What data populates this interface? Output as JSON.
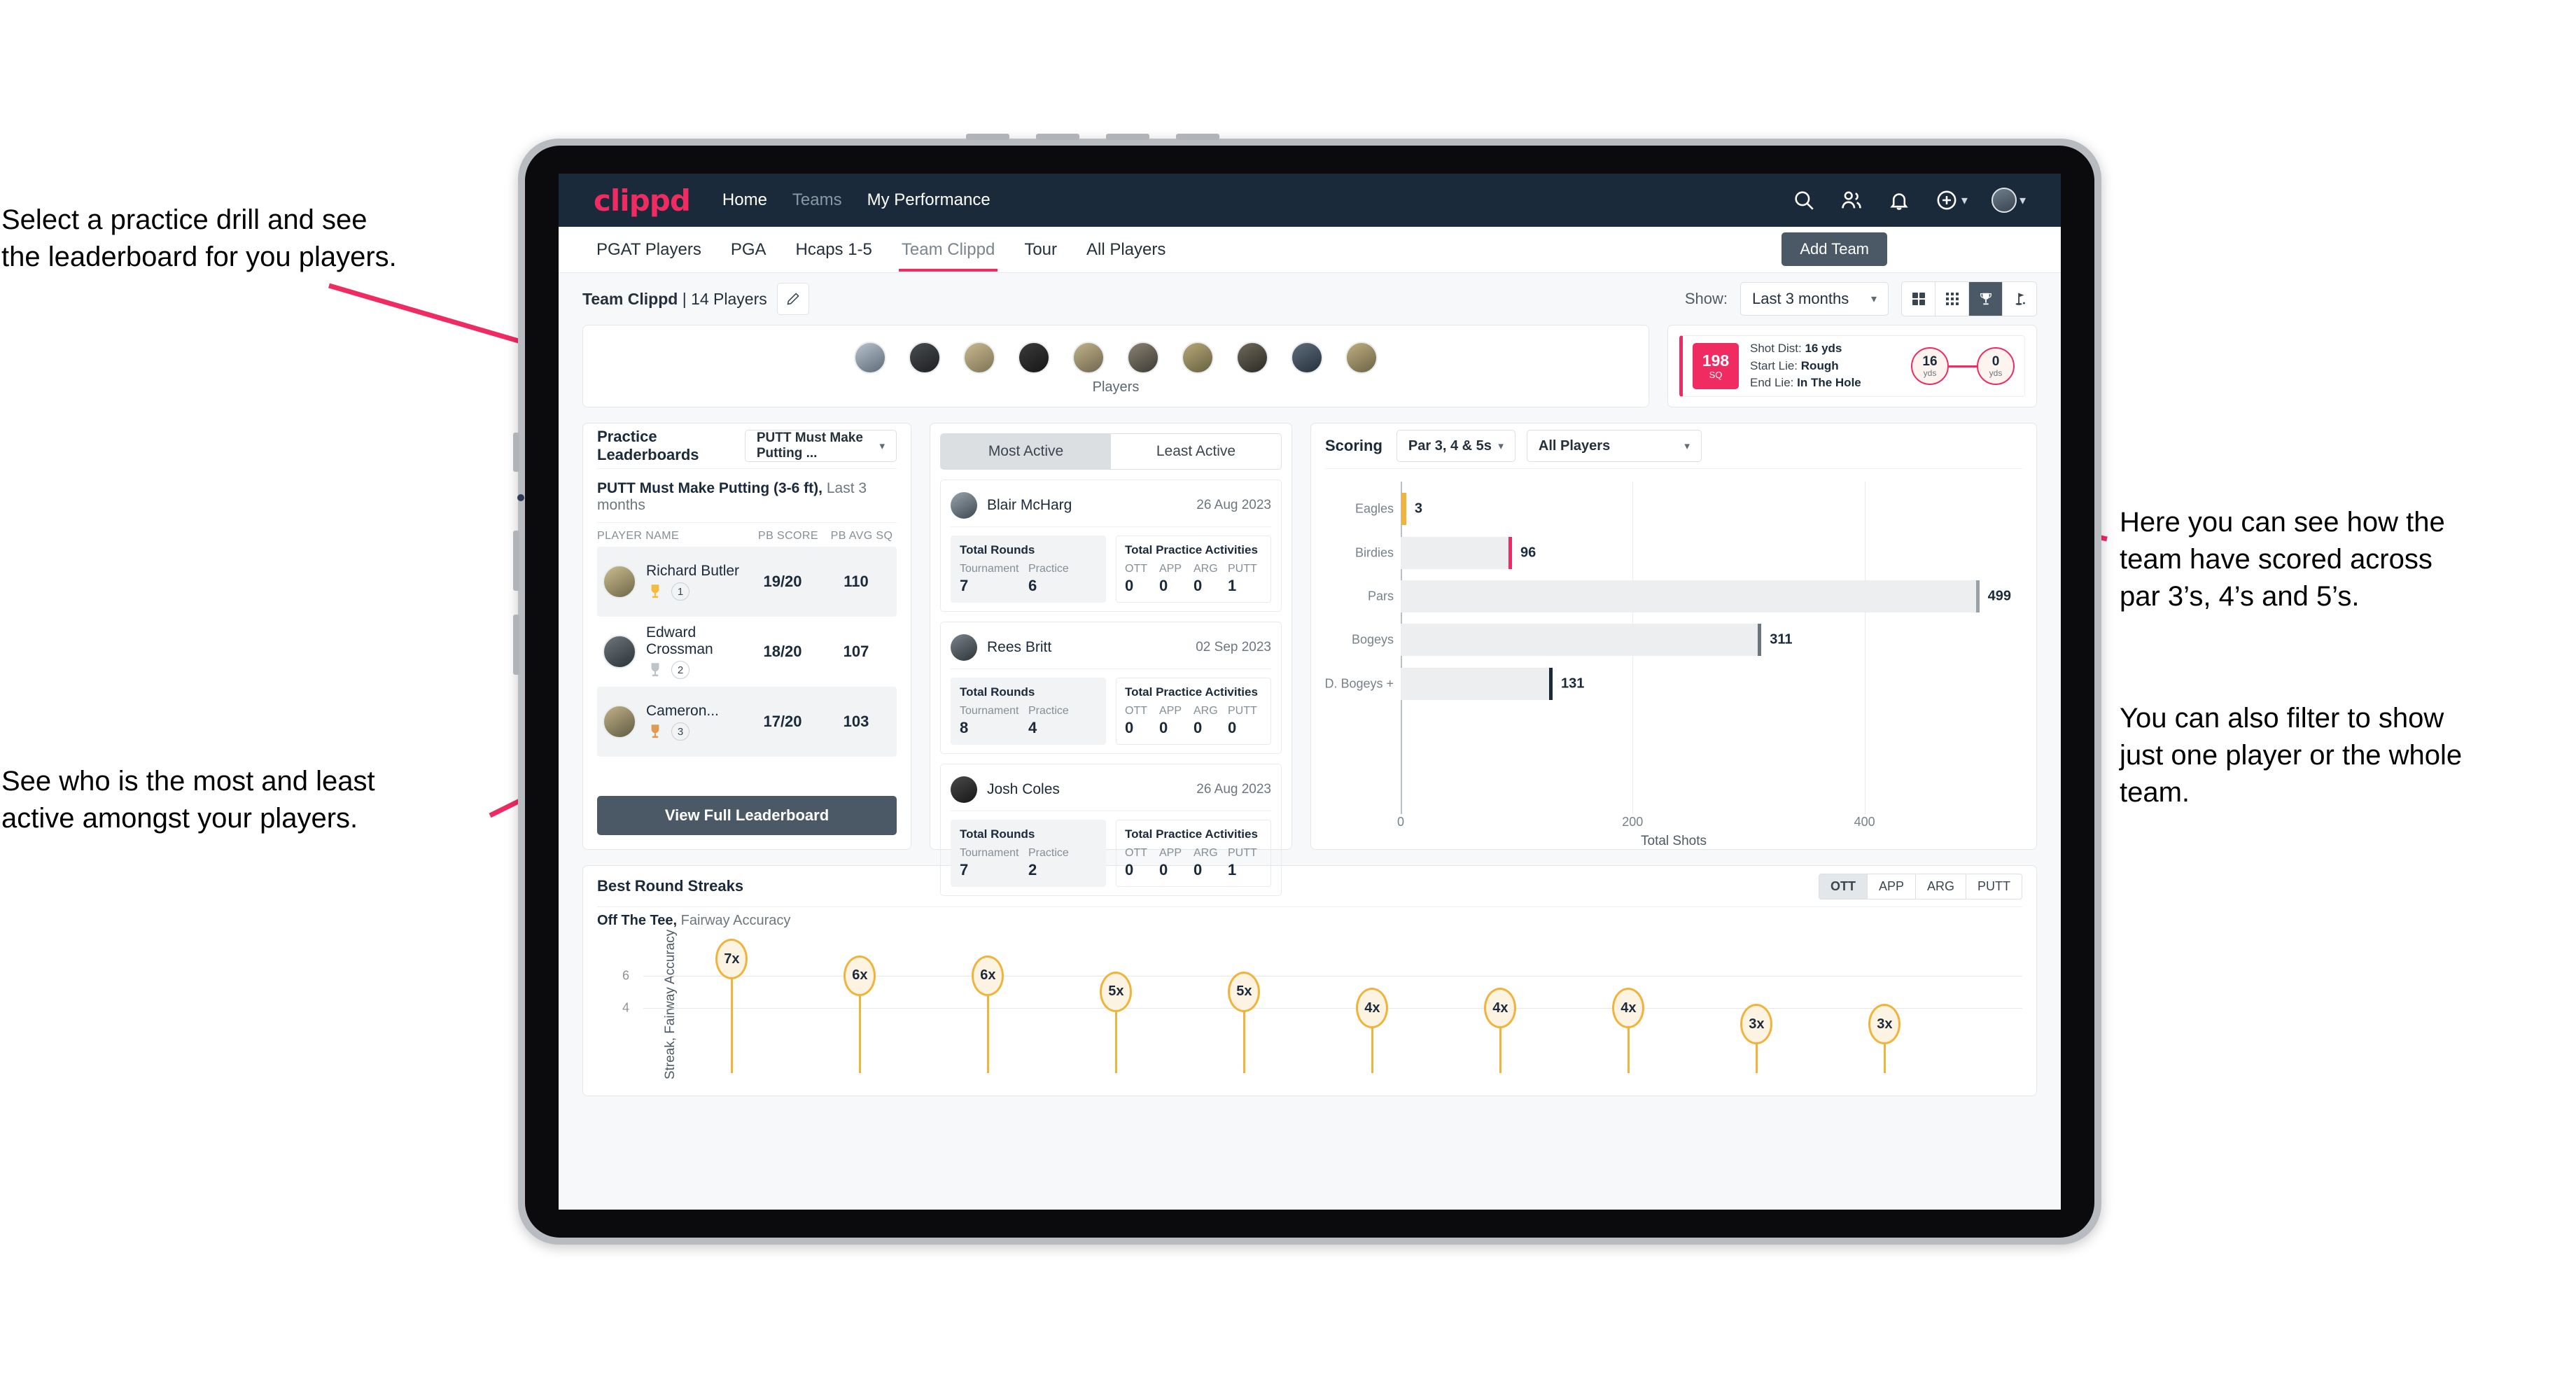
{
  "annotations": [
    {
      "id": "a1",
      "text": "Select a practice drill and see\nthe leaderboard for you players."
    },
    {
      "id": "a2",
      "text": "See who is the most and least\nactive amongst your players."
    },
    {
      "id": "a3",
      "text": "Here you can see how the\nteam have scored across\npar 3’s, 4’s and 5’s."
    },
    {
      "id": "a4",
      "text": "You can also filter to show\njust one player or the whole\nteam."
    }
  ],
  "topnav": {
    "logo": "clippd",
    "links": [
      {
        "label": "Home",
        "active": true
      },
      {
        "label": "Teams",
        "active": false
      },
      {
        "label": "My Performance",
        "active": true
      }
    ],
    "icons": [
      "search-icon",
      "people-icon",
      "bell-icon",
      "plus-circle-icon",
      "avatar"
    ]
  },
  "tabs": {
    "items": [
      "PGAT Players",
      "PGA",
      "Hcaps 1-5",
      "Team Clippd",
      "Tour",
      "All Players"
    ],
    "active": "Team Clippd",
    "add_team_label": "Add Team"
  },
  "toolbar": {
    "team_name": "Team Clippd",
    "team_separator": " | ",
    "team_players": "14 Players",
    "edit_icon": "pencil-icon",
    "show_label": "Show:",
    "range_value": "Last 3 months",
    "view_icons": [
      "grid-large-icon",
      "grid-small-icon",
      "trophy-icon",
      "flag-icon"
    ],
    "view_active_index": 2
  },
  "players_strip": {
    "label": "Players",
    "count": 10
  },
  "shot_card": {
    "sq_value": "198",
    "sq_label": "SQ",
    "lines": [
      {
        "k": "Shot Dist:",
        "v": "16 yds"
      },
      {
        "k": "Start Lie:",
        "v": "Rough"
      },
      {
        "k": "End Lie:",
        "v": "In The Hole"
      }
    ],
    "start_dist": "16",
    "start_unit": "yds",
    "end_dist": "0",
    "end_unit": "yds"
  },
  "leaderboard": {
    "title": "Practice Leaderboards",
    "drill_select": "PUTT Must Make Putting ...",
    "subtitle_bold": "PUTT Must Make Putting (3-6 ft),",
    "subtitle_rest": " Last 3 months",
    "columns": [
      "PLAYER NAME",
      "PB SCORE",
      "PB AVG SQ"
    ],
    "rows": [
      {
        "name": "Richard Butler",
        "rank": "1",
        "score": "19/20",
        "sq": "110",
        "medal": "gold"
      },
      {
        "name": "Edward Crossman",
        "rank": "2",
        "score": "18/20",
        "sq": "107",
        "medal": "silver"
      },
      {
        "name": "Cameron...",
        "rank": "3",
        "score": "17/20",
        "sq": "103",
        "medal": "bronze"
      }
    ],
    "button_label": "View Full Leaderboard"
  },
  "activity": {
    "tabs": [
      "Most Active",
      "Least Active"
    ],
    "active_tab": "Most Active",
    "rounds_title": "Total Rounds",
    "rounds_keys": [
      "Tournament",
      "Practice"
    ],
    "practice_title": "Total Practice Activities",
    "practice_keys": [
      "OTT",
      "APP",
      "ARG",
      "PUTT"
    ],
    "cards": [
      {
        "name": "Blair McHarg",
        "date": "26 Aug 2023",
        "tournament": "7",
        "practice": "6",
        "ott": "0",
        "app": "0",
        "arg": "0",
        "putt": "1"
      },
      {
        "name": "Rees Britt",
        "date": "02 Sep 2023",
        "tournament": "8",
        "practice": "4",
        "ott": "0",
        "app": "0",
        "arg": "0",
        "putt": "0"
      },
      {
        "name": "Josh Coles",
        "date": "26 Aug 2023",
        "tournament": "7",
        "practice": "2",
        "ott": "0",
        "app": "0",
        "arg": "0",
        "putt": "1"
      }
    ]
  },
  "scoring": {
    "title": "Scoring",
    "par_filter": "Par 3, 4 & 5s",
    "player_filter": "All Players",
    "chart_data": {
      "type": "bar",
      "orientation": "horizontal",
      "title": "Scoring",
      "categories": [
        "Eagles",
        "Birdies",
        "Pars",
        "Bogeys",
        "D. Bogeys +"
      ],
      "values": [
        3,
        96,
        499,
        311,
        131
      ],
      "cap_colors": [
        "#f0b43c",
        "#ef2b62",
        "#9aa2a9",
        "#6b757d",
        "#1b2a3a"
      ],
      "xlabel": "Total Shots",
      "ylabel": "",
      "xticks": [
        0,
        200,
        400
      ],
      "xlim": [
        0,
        530
      ],
      "grid": true,
      "legend": "none"
    }
  },
  "streaks": {
    "title": "Best Round Streaks",
    "segments": [
      "OTT",
      "APP",
      "ARG",
      "PUTT"
    ],
    "active_segment": "OTT",
    "subtitle_bold": "Off The Tee,",
    "subtitle_rest": " Fairway Accuracy",
    "chart_data": {
      "type": "bar",
      "title": "Best Round Streaks — Off The Tee, Fairway Accuracy",
      "ylabel": "Streak, Fairway Accuracy",
      "xlabel": "",
      "yticks": [
        4,
        6
      ],
      "ylim": [
        0,
        8
      ],
      "grid": true,
      "categories": [
        "p1",
        "p2",
        "p3",
        "p4",
        "p5",
        "p6",
        "p7",
        "p8",
        "p9",
        "p10"
      ],
      "values": [
        7,
        6,
        6,
        5,
        5,
        4,
        4,
        4,
        3,
        3
      ],
      "labels": [
        "7x",
        "6x",
        "6x",
        "5x",
        "5x",
        "4x",
        "4x",
        "4x",
        "3x",
        "3x"
      ]
    }
  },
  "colors": {
    "brand_pink": "#ef2b62",
    "navy": "#1b2a3a",
    "slate": "#4b5966",
    "amber": "#f0b43c"
  }
}
